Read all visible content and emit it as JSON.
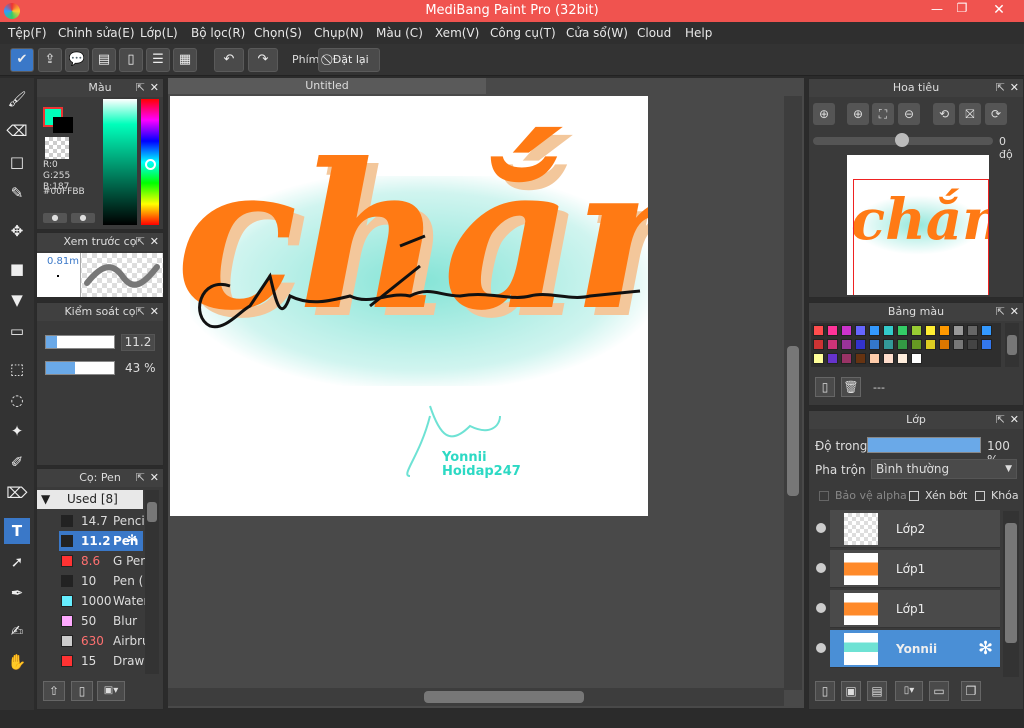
{
  "window": {
    "title": "MediBang Paint Pro (32bit)"
  },
  "menu": [
    "Tệp(F)",
    "Chỉnh sửa(E)",
    "Lớp(L)",
    "Bộ lọc(R)",
    "Chọn(S)",
    "Chụp(N)",
    "Màu (C)",
    "Xem(V)",
    "Công cụ(T)",
    "Cửa sổ(W)",
    "Cloud",
    "Help"
  ],
  "toolbar": {
    "shortcut_label": "Phím",
    "reset_label": "Đặt lại"
  },
  "color_panel": {
    "title": "Màu",
    "r": "R:0",
    "g": "G:255",
    "b": "B:187",
    "hex": "#00FFBB",
    "primary": "#00ffbb"
  },
  "brush_preview": {
    "title": "Xem trước cọ",
    "size": "0.81m"
  },
  "brush_control": {
    "title": "Kiểm soát cọ",
    "size_value": "11.2",
    "opacity_value": "43 %"
  },
  "brush_list": {
    "title": "Cọ: Pen",
    "group": "Used [8]",
    "items": [
      {
        "size": "14.7",
        "name": "Pencil",
        "color": "#222222"
      },
      {
        "size": "11.2",
        "name": "Pen",
        "color": "#222222",
        "selected": true
      },
      {
        "size": "8.6",
        "name": "G Pen",
        "color": "#ff3333"
      },
      {
        "size": "10",
        "name": "Pen (",
        "color": "#222222"
      },
      {
        "size": "1000",
        "name": "Water",
        "color": "#66eeff"
      },
      {
        "size": "50",
        "name": "Blur",
        "color": "#ffaaff"
      },
      {
        "size": "630",
        "name": "Airbru",
        "color": "#cccccc"
      },
      {
        "size": "15",
        "name": "Drawi",
        "color": "#ff3333"
      }
    ]
  },
  "canvas": {
    "tab": "Untitled",
    "art_main": "chắn",
    "art_sig1": "Yonnii",
    "art_sig2": "Hoidap247"
  },
  "navigator": {
    "title": "Hoa tiêu",
    "angle": "0 độ"
  },
  "palette": {
    "title": "Bảng màu",
    "value": "---",
    "colors": [
      "#ff4d4d",
      "#ff3399",
      "#cc33cc",
      "#6666ff",
      "#3399ff",
      "#33cccc",
      "#33cc66",
      "#99cc33",
      "#ffee33",
      "#ff9900",
      "#999999",
      "#666666",
      "#3399ff",
      "#cc3333",
      "#cc3377",
      "#993399",
      "#3333cc",
      "#3377cc",
      "#339999",
      "#339944",
      "#669922",
      "#ddcc22",
      "#dd7700",
      "#777777",
      "#444444",
      "#3377ee",
      "#ffff99",
      "#6633cc",
      "#993366",
      "#663311",
      "#ffccaa",
      "#ffddcc",
      "#ffeedd",
      "#ffffff"
    ]
  },
  "layers": {
    "title": "Lớp",
    "opacity_label": "Độ trong",
    "opacity_value": "100 %",
    "blend_label": "Pha trộn",
    "blend_value": "Bình thường",
    "protect_alpha": "Bảo vệ alpha",
    "clipping": "Xén bớt",
    "lock": "Khóa",
    "items": [
      {
        "name": "Lớp2",
        "selected": false
      },
      {
        "name": "Lớp1",
        "selected": false
      },
      {
        "name": "Lớp1",
        "selected": false
      },
      {
        "name": "Yonnii",
        "selected": true
      }
    ]
  }
}
